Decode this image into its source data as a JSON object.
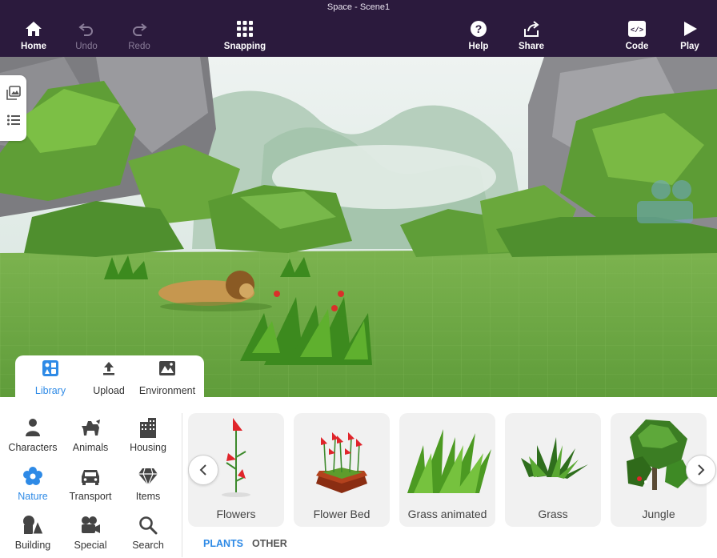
{
  "window_title": "Space - Scene1",
  "toolbar": {
    "home": "Home",
    "undo": "Undo",
    "redo": "Redo",
    "snapping": "Snapping",
    "help": "Help",
    "share": "Share",
    "code": "Code",
    "play": "Play"
  },
  "tabs": [
    {
      "label": "Library",
      "active": true
    },
    {
      "label": "Upload"
    },
    {
      "label": "Environment"
    }
  ],
  "categories": [
    {
      "label": "Characters",
      "icon": "person-icon"
    },
    {
      "label": "Animals",
      "icon": "dog-icon"
    },
    {
      "label": "Housing",
      "icon": "building-icon"
    },
    {
      "label": "Nature",
      "icon": "flower-icon",
      "active": true
    },
    {
      "label": "Transport",
      "icon": "car-icon"
    },
    {
      "label": "Items",
      "icon": "gem-icon"
    },
    {
      "label": "Building",
      "icon": "shapes-icon"
    },
    {
      "label": "Special",
      "icon": "camera-icon"
    },
    {
      "label": "Search",
      "icon": "search-icon"
    }
  ],
  "items": [
    {
      "label": "Flowers"
    },
    {
      "label": "Flower Bed"
    },
    {
      "label": "Grass animated"
    },
    {
      "label": "Grass"
    },
    {
      "label": "Jungle"
    }
  ],
  "subtabs": [
    {
      "label": "PLANTS",
      "active": true
    },
    {
      "label": "OTHER"
    }
  ],
  "colors": {
    "topbar": "#2b1a3d",
    "accent": "#2e8ae6",
    "grass": "#6fa84a"
  }
}
